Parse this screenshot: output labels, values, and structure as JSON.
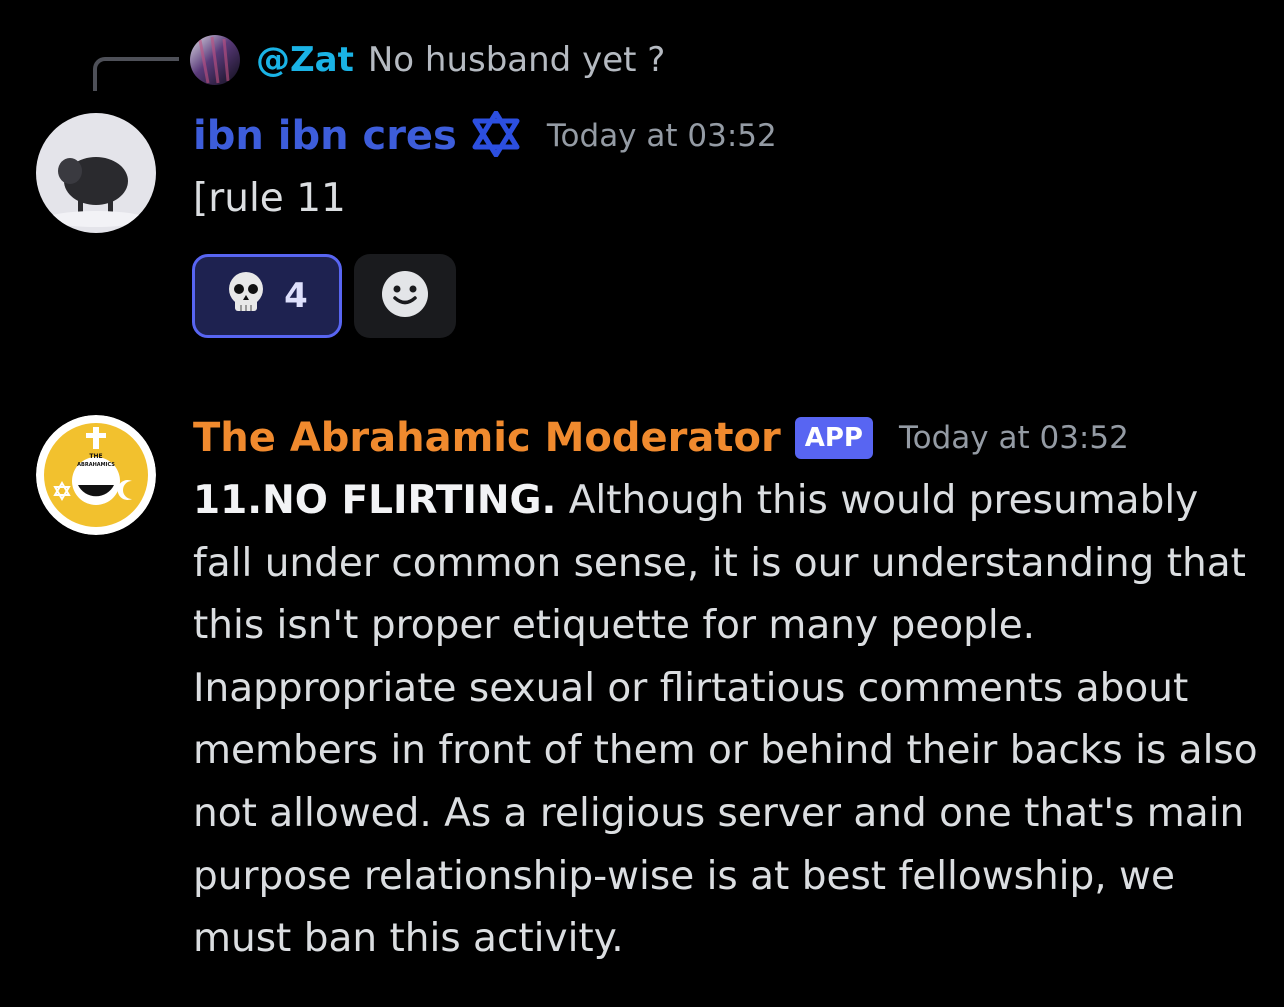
{
  "reply": {
    "author": "@Zat",
    "text": "No husband yet ?",
    "author_color": "#1ab3e5"
  },
  "message1": {
    "author": "ibn ibn cres",
    "author_color": "#3d5ddb",
    "badge_icon": "star-of-david-icon",
    "timestamp": "Today at 03:52",
    "body": "[rule 11",
    "reactions": [
      {
        "emoji": "💀",
        "count": "4",
        "active": true
      }
    ],
    "add_reaction_icon": "smiley-face-icon"
  },
  "message2": {
    "author": "The Abrahamic Moderator",
    "author_color": "#f08a2e",
    "badge": "APP",
    "timestamp": "Today at 03:52",
    "avatar_text": "THE ABRAHAMICS",
    "rule_heading": "11.NO FLIRTING.",
    "rule_body": " Although this would presumably fall under common sense, it is our understanding that this isn't proper etiquette for many people. Inappropriate sexual or flirtatious comments about members in front of them or behind their backs is also not allowed. As a religious server and one that's main purpose relationship-wise is at best fellowship, we must ban this activity."
  },
  "colors": {
    "background": "#000000",
    "text": "#dbdee1",
    "muted": "#949ba4",
    "accent": "#5865f2"
  }
}
